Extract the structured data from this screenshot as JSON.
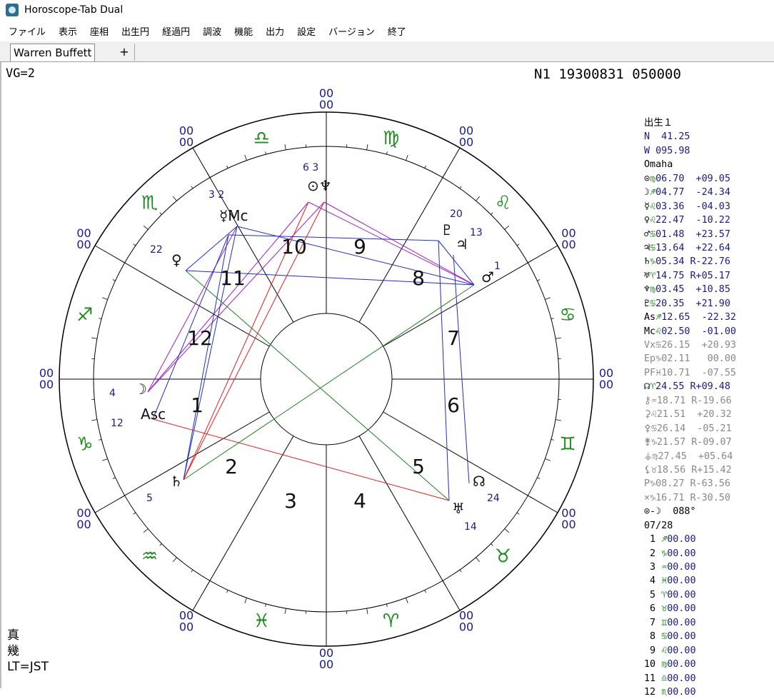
{
  "window": {
    "title": "Horoscope-Tab Dual"
  },
  "menu": [
    "ファイル",
    "表示",
    "座相",
    "出生円",
    "経過円",
    "調波",
    "機能",
    "出力",
    "設定",
    "バージョン",
    "終了"
  ],
  "tabs": {
    "active": "Warren Buffett",
    "add": "+"
  },
  "header": {
    "vg": "VG=2",
    "chart_id": "N1 19300831 050000"
  },
  "footer": {
    "line1": "真",
    "line2": "幾",
    "line3": "LT=JST"
  },
  "side": {
    "title": "出生１",
    "lat": "N  41.25",
    "lon": "W 095.98",
    "place": "Omaha",
    "planets": [
      {
        "glyph": "⊙",
        "sign": "♍",
        "text": "06.70  +09.05",
        "style": "blu"
      },
      {
        "glyph": "☽",
        "sign": "♐",
        "text": "04.77  -24.34",
        "style": "blu"
      },
      {
        "glyph": "☿",
        "sign": "♌",
        "text": "03.36  -04.03",
        "style": "blu"
      },
      {
        "glyph": "♀",
        "sign": "♌",
        "text": "22.47  -10.22",
        "style": "blu"
      },
      {
        "glyph": "♂",
        "sign": "♋",
        "text": "01.48  +23.57",
        "style": "blu"
      },
      {
        "glyph": "♃",
        "sign": "♋",
        "text": "13.64  +22.64",
        "style": "blu"
      },
      {
        "glyph": "♄",
        "sign": "♑",
        "text": "05.34 R-22.76",
        "style": "blu"
      },
      {
        "glyph": "♅",
        "sign": "♈",
        "text": "14.75 R+05.17",
        "style": "blu"
      },
      {
        "glyph": "♆",
        "sign": "♍",
        "text": "03.45  +10.85",
        "style": "blu"
      },
      {
        "glyph": "♇",
        "sign": "♋",
        "text": "20.35  +21.90",
        "style": "blu"
      },
      {
        "glyph": "Asc",
        "sign": "♐",
        "text": "12.65  -22.32",
        "style": "blu"
      },
      {
        "glyph": "Mc",
        "sign": "♌",
        "text": "02.50  -01.00",
        "style": "blu"
      },
      {
        "glyph": "Vx",
        "sign": "♋",
        "text": "26.15  +20.93",
        "style": "gry"
      },
      {
        "glyph": "Ep",
        "sign": "♑",
        "text": "02.11   00.00",
        "style": "gry"
      },
      {
        "glyph": "PF",
        "sign": "♓",
        "text": "10.71  -07.55",
        "style": "gry"
      },
      {
        "glyph": "☊",
        "sign": "♈",
        "text": "24.55 R+09.48",
        "style": "blu"
      },
      {
        "glyph": "⚷",
        "sign": "♒",
        "text": "18.71 R-19.66",
        "style": "gry"
      },
      {
        "glyph": "⚳",
        "sign": "♌",
        "text": "21.51  +20.32",
        "style": "gry"
      },
      {
        "glyph": "⚴",
        "sign": "♋",
        "text": "26.14  -05.21",
        "style": "gry"
      },
      {
        "glyph": "⚵",
        "sign": "♑",
        "text": "21.57 R-09.07",
        "style": "gry"
      },
      {
        "glyph": "⚶",
        "sign": "♍",
        "text": "27.45  +05.64",
        "style": "gry"
      },
      {
        "glyph": "⚸",
        "sign": "♉",
        "text": "18.56 R+15.42",
        "style": "gry"
      },
      {
        "glyph": "P",
        "sign": "♑",
        "text": "08.27 R-63.56",
        "style": "gry"
      },
      {
        "glyph": "×",
        "sign": "♑",
        "text": "16.71 R-30.50",
        "style": "gry"
      }
    ],
    "phase": "⊙-☽  088°",
    "date": "07/28",
    "houses": [
      {
        "n": " 1",
        "sign": "♐",
        "deg": "00.00"
      },
      {
        "n": " 2",
        "sign": "♑",
        "deg": "00.00"
      },
      {
        "n": " 3",
        "sign": "♒",
        "deg": "00.00"
      },
      {
        "n": " 4",
        "sign": "♓",
        "deg": "00.00"
      },
      {
        "n": " 5",
        "sign": "♈",
        "deg": "00.00"
      },
      {
        "n": " 6",
        "sign": "♉",
        "deg": "00.00"
      },
      {
        "n": " 7",
        "sign": "♊",
        "deg": "00.00"
      },
      {
        "n": " 8",
        "sign": "♋",
        "deg": "00.00"
      },
      {
        "n": " 9",
        "sign": "♌",
        "deg": "00.00"
      },
      {
        "n": "10",
        "sign": "♍",
        "deg": "00.00"
      },
      {
        "n": "11",
        "sign": "♎",
        "deg": "00.00"
      },
      {
        "n": "12",
        "sign": "♏",
        "deg": "00.00"
      }
    ]
  },
  "wheel": {
    "signs": [
      "♍",
      "♌",
      "♋",
      "♊",
      "♉",
      "♈",
      "♓",
      "♒",
      "♑",
      "♐",
      "♏",
      "♎"
    ],
    "house_numbers": [
      "10",
      "9",
      "8",
      "7",
      "6",
      "5",
      "4",
      "3",
      "2",
      "1",
      "12",
      "11"
    ],
    "cusp_labels": [
      "00",
      "00",
      "00",
      "00",
      "00",
      "00",
      "00",
      "00",
      "00",
      "00",
      "00",
      "00"
    ],
    "planets": [
      {
        "name": "sun-neptune",
        "label": "⊙♆",
        "deg_label": "6  3"
      },
      {
        "name": "mercury-mc",
        "label": "☿Mc",
        "deg_label": "3  2"
      },
      {
        "name": "venus",
        "label": "♀",
        "deg_label": "22"
      },
      {
        "name": "moon",
        "label": "☽",
        "deg_label": "4"
      },
      {
        "name": "asc",
        "label": "Asc",
        "deg_label": "12"
      },
      {
        "name": "saturn",
        "label": "♄",
        "deg_label": "5"
      },
      {
        "name": "uranus",
        "label": "♅",
        "deg_label": "14"
      },
      {
        "name": "node",
        "label": "☊",
        "deg_label": "24"
      },
      {
        "name": "mars",
        "label": "♂",
        "deg_label": "1"
      },
      {
        "name": "jupiter",
        "label": "♃",
        "deg_label": "13"
      },
      {
        "name": "pluto",
        "label": "♇",
        "deg_label": "20"
      }
    ]
  }
}
